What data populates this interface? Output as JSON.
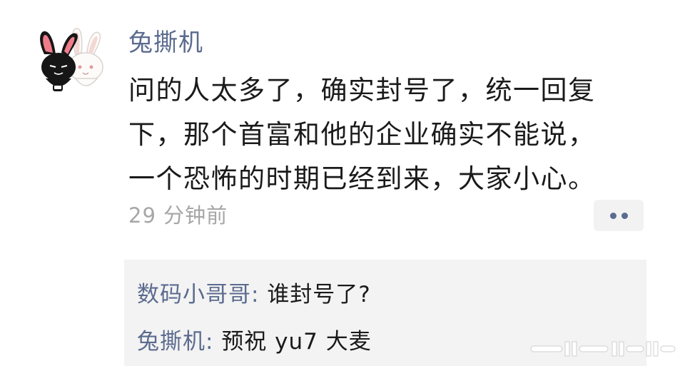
{
  "post": {
    "author": "兔撕机",
    "lines": [
      "问的人太多了，确实封号了，统一回复",
      "下，那个首富和他的企业确实不能说，",
      "一个恐怖的时期已经到来，大家小心。"
    ],
    "time": "29 分钟前"
  },
  "comments": [
    {
      "user": "数码小哥哥",
      "sep": ": ",
      "text": "谁封号了?"
    },
    {
      "user": "兔撕机",
      "sep": ": ",
      "text": "预祝 yu7 大麦"
    }
  ],
  "icons": {
    "avatar": "rabbit-pair-icon",
    "more": "more-dots-icon"
  },
  "colors": {
    "name": "#5b6b8f",
    "body": "#1a1a1a",
    "time": "#a6a6a6",
    "comment_bg": "#f3f3f3"
  }
}
